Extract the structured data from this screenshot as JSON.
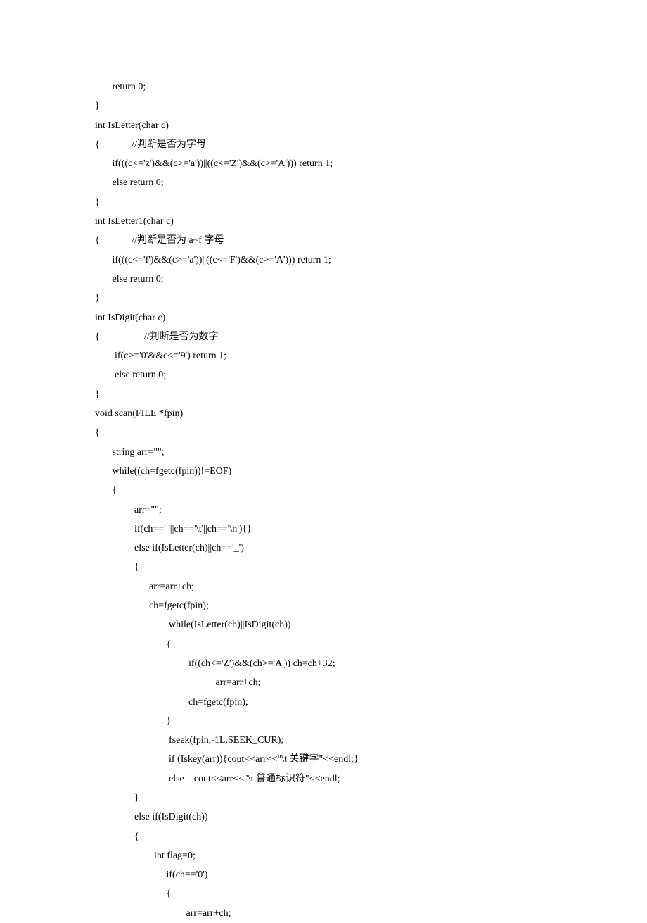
{
  "code_lines": [
    "       return 0;",
    "}",
    "int IsLetter(char c)",
    "{             //判断是否为字母",
    "       if(((c<='z')&&(c>='a'))||((c<='Z')&&(c>='A'))) return 1;",
    "       else return 0;",
    "}",
    "int IsLetter1(char c)",
    "{             //判断是否为 a~f 字母",
    "       if(((c<='f')&&(c>='a'))||((c<='F')&&(c>='A'))) return 1;",
    "       else return 0;",
    "}",
    "int IsDigit(char c)",
    "{                  //判断是否为数字",
    "        if(c>='0'&&c<='9') return 1;",
    "        else return 0;",
    "}",
    "void scan(FILE *fpin)",
    "{",
    "       string arr=\"\";",
    "       while((ch=fgetc(fpin))!=EOF)",
    "       {",
    "                arr=\"\";",
    "                if(ch==' '||ch=='\\t'||ch=='\\n'){}",
    "                else if(IsLetter(ch)||ch=='_')",
    "                {",
    "                      arr=arr+ch;",
    "                      ch=fgetc(fpin);",
    "                              while(IsLetter(ch)||IsDigit(ch))",
    "                             {",
    "                                      if((ch<='Z')&&(ch>='A')) ch=ch+32;",
    "                                                 arr=arr+ch;",
    "                                      ch=fgetc(fpin);",
    "                             }",
    "                              fseek(fpin,-1L,SEEK_CUR);",
    "                              if (Iskey(arr)){cout<<arr<<\"\\t 关键字\"<<endl;}",
    "                              else    cout<<arr<<\"\\t 普通标识符\"<<endl;",
    "                }",
    "                else if(IsDigit(ch))",
    "                {",
    "                        int flag=0;",
    "                             if(ch=='0')",
    "                             {",
    "                                     arr=arr+ch;"
  ]
}
